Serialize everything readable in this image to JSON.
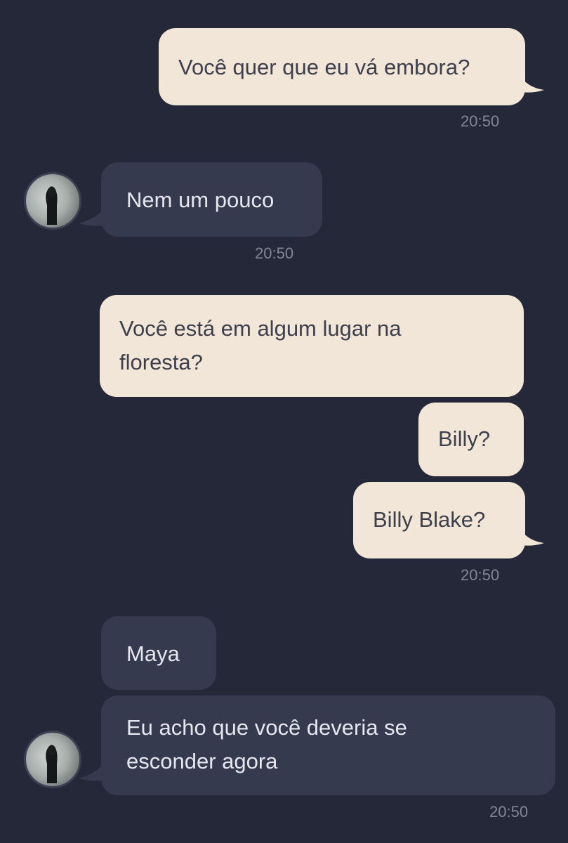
{
  "messages": [
    {
      "text": "Você quer que eu vá embora?"
    },
    {
      "text": "Nem um pouco"
    },
    {
      "text": "Você está em algum lugar na floresta?"
    },
    {
      "text": "Billy?"
    },
    {
      "text": "Billy Blake?"
    },
    {
      "text": "Maya"
    },
    {
      "text": "Eu acho que você deveria se esconder agora"
    }
  ],
  "times": [
    "20:50",
    "20:50",
    "20:50",
    "20:50"
  ],
  "colors": {
    "background": "#252838",
    "outgoing_bubble": "#f2e6d8",
    "incoming_bubble": "#363a4e",
    "timestamp": "#828596"
  },
  "avatar": {
    "icon": "hooded-figure-avatar"
  }
}
